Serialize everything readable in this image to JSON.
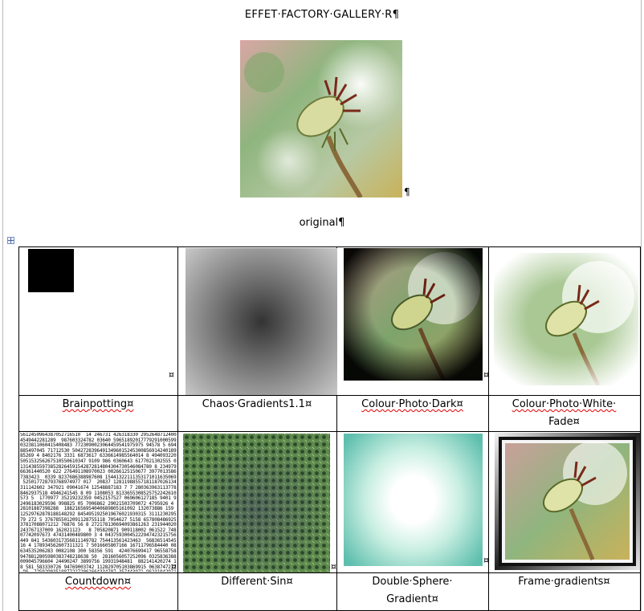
{
  "document": {
    "title": "EFFET·FACTORY·GALLERY·R¶",
    "original_caption": "original¶",
    "hero_mark": "¶",
    "cell_mark": "¤"
  },
  "gallery": [
    {
      "caption": "Brainpotting¤",
      "underline": "Brainpotting"
    },
    {
      "caption": "Chaos·Gradients1.1¤"
    },
    {
      "caption_line1": "Colour·Photo·Dark¤",
      "underline": "Colour·Photo·Dark"
    },
    {
      "caption_line1": "Colour·Photo·White·",
      "caption_line2": "Fade¤",
      "underline": "Colour·Photo·White"
    },
    {
      "caption": "Countdown¤",
      "underline": "Countdown"
    },
    {
      "caption": "Different·Sin¤"
    },
    {
      "caption_line1": "Double·Sphere·",
      "caption_line2": "Gradient¤"
    },
    {
      "caption": "Frame·gradients¤"
    }
  ]
}
